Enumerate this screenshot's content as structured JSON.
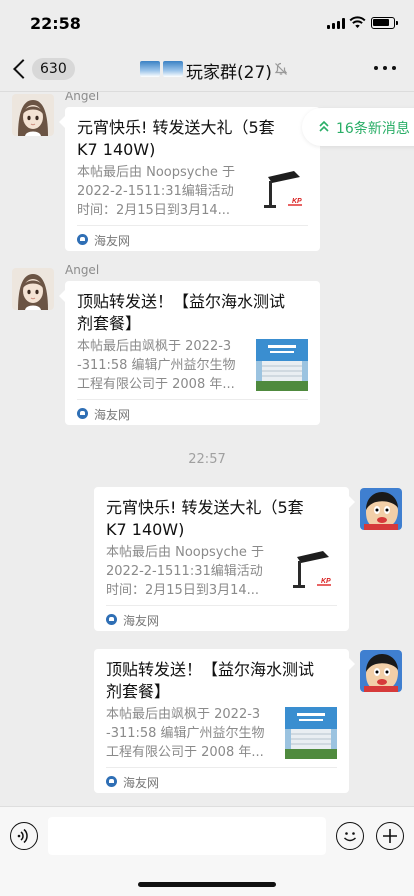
{
  "status_bar": {
    "time": "22:58"
  },
  "nav": {
    "back_count": "630",
    "title": "玩家群(27)",
    "icons": [
      "back-chevron-icon",
      "group-avatar-icon",
      "mute-icon",
      "more-icon"
    ]
  },
  "new_messages": {
    "label": "16条新消息",
    "icon": "double-chevron-up-icon"
  },
  "timestamp": "22:57",
  "messages": [
    {
      "sender": "Angel",
      "side": "left",
      "title_lines": [
        "元宵快乐! 转发送大礼（5套",
        "K7 140W)"
      ],
      "desc_lines": [
        "本帖最后由 Noopsyche 于",
        "2022-2-1511:31编辑活动",
        "时间：2月15日到3月14..."
      ],
      "source": "海友网",
      "thumb": "lamp"
    },
    {
      "sender": "Angel",
      "side": "left",
      "title_lines": [
        "顶贴转发送！【益尔海水测试",
        "剂套餐】"
      ],
      "desc_lines": [
        "本帖最后由飒枫于 2022-3",
        "-311:58 编辑广州益尔生物",
        "工程有限公司于 2008 年..."
      ],
      "source": "海友网",
      "thumb": "building"
    },
    {
      "sender": "",
      "side": "right",
      "title_lines": [
        "元宵快乐! 转发送大礼（5套",
        "K7 140W)"
      ],
      "desc_lines": [
        "本帖最后由 Noopsyche 于",
        "2022-2-1511:31编辑活动",
        "时间：2月15日到3月14..."
      ],
      "source": "海友网",
      "thumb": "lamp"
    },
    {
      "sender": "",
      "side": "right",
      "title_lines": [
        "顶贴转发送！【益尔海水测试",
        "剂套餐】"
      ],
      "desc_lines": [
        "本帖最后由飒枫于 2022-3",
        "-311:58 编辑广州益尔生物",
        "工程有限公司于 2008 年..."
      ],
      "source": "海友网",
      "thumb": "building"
    }
  ],
  "input_bar": {
    "placeholder": "",
    "icons": [
      "voice-icon",
      "emoji-icon",
      "plus-icon"
    ]
  },
  "colors": {
    "accent_green": "#2aae67",
    "background": "#ededed"
  }
}
